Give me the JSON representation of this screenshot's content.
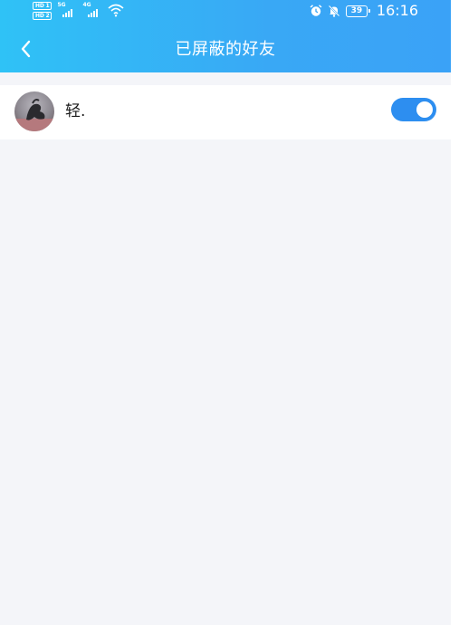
{
  "status_bar": {
    "sim1_badge": "HD 1",
    "sim2_badge": "HD 2",
    "sim1_network": "5G",
    "sim2_network": "4G",
    "battery_level": "39",
    "time": "16:16",
    "icons": [
      "alarm-icon",
      "bell-muted-icon",
      "wifi-icon",
      "signal-icon"
    ]
  },
  "header": {
    "back_icon": "chevron-left-icon",
    "title": "已屏蔽的好友"
  },
  "friends": [
    {
      "name": "轻.",
      "blocked": true
    }
  ],
  "colors": {
    "header_start": "#2fc2f6",
    "header_end": "#3aa2f7",
    "toggle_on": "#2d8ef0",
    "page_background": "#f4f5f9"
  }
}
